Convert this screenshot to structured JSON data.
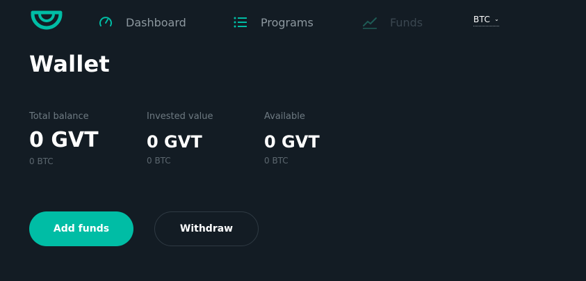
{
  "header": {
    "nav": [
      {
        "label": "Dashboard",
        "icon": "gauge-icon"
      },
      {
        "label": "Programs",
        "icon": "list-icon"
      },
      {
        "label": "Funds",
        "icon": "line-chart-icon"
      }
    ],
    "currency_select": {
      "value": "BTC",
      "icon": "chevron-down-icon"
    }
  },
  "main": {
    "title": "Wallet",
    "stats": [
      {
        "label": "Total balance",
        "value": "0 GVT",
        "sub": "0 BTC"
      },
      {
        "label": "Invested value",
        "value": "0 GVT",
        "sub": "0 BTC"
      },
      {
        "label": "Available",
        "value": "0 GVT",
        "sub": "0 BTC"
      }
    ],
    "buttons": {
      "add_funds": "Add funds",
      "withdraw": "Withdraw"
    }
  },
  "colors": {
    "background": "#131c24",
    "accent": "#00bda5",
    "nav_text": "#8d989f",
    "nav_disabled": "#3a4650"
  }
}
